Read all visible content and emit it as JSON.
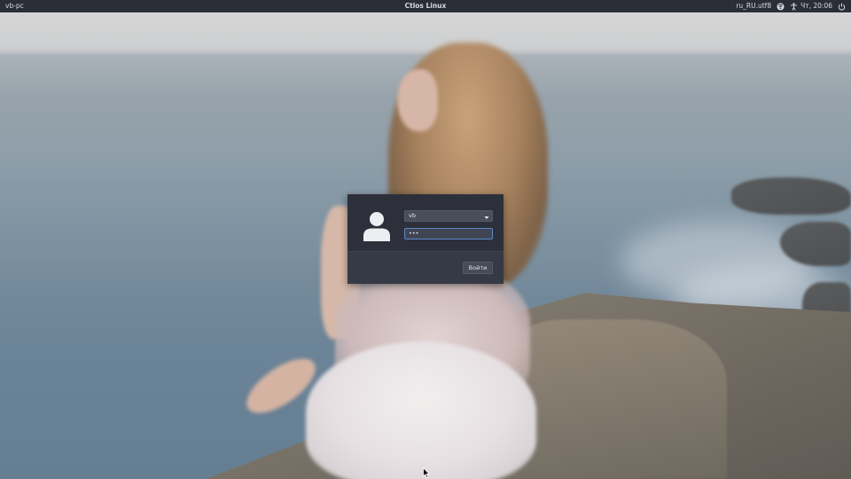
{
  "top_panel": {
    "hostname": "vb-pc",
    "title": "Ctlos Linux",
    "locale": "ru_RU.utf8",
    "clock": "Чт, 20:06",
    "icons": [
      "network-icon",
      "accessibility-icon",
      "power-icon"
    ]
  },
  "login": {
    "avatar_icon": "user-avatar-icon",
    "username": "vb",
    "password_mask": "•••",
    "login_button": "Войти"
  },
  "colors": {
    "panel_bg": "#2b2e37",
    "dialog_bg": "#2d303b",
    "focus_border": "#5a87c7"
  }
}
